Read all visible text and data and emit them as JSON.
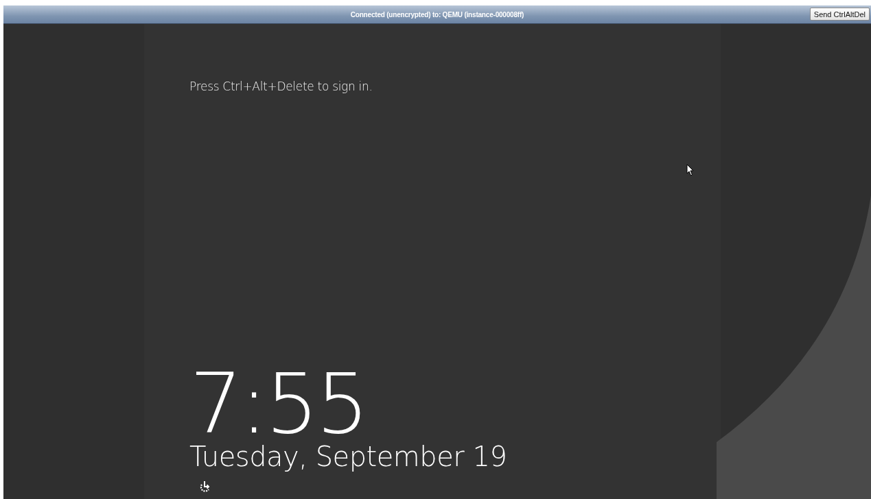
{
  "vnc_bar": {
    "status": "Connected (unencrypted) to: QEMU (instance-000008ff)",
    "button": "Send CtrlAltDel"
  },
  "lock_screen": {
    "prompt": "Press Ctrl+Alt+Delete to sign in.",
    "time": "7:55",
    "date": "Tuesday, September 19"
  }
}
